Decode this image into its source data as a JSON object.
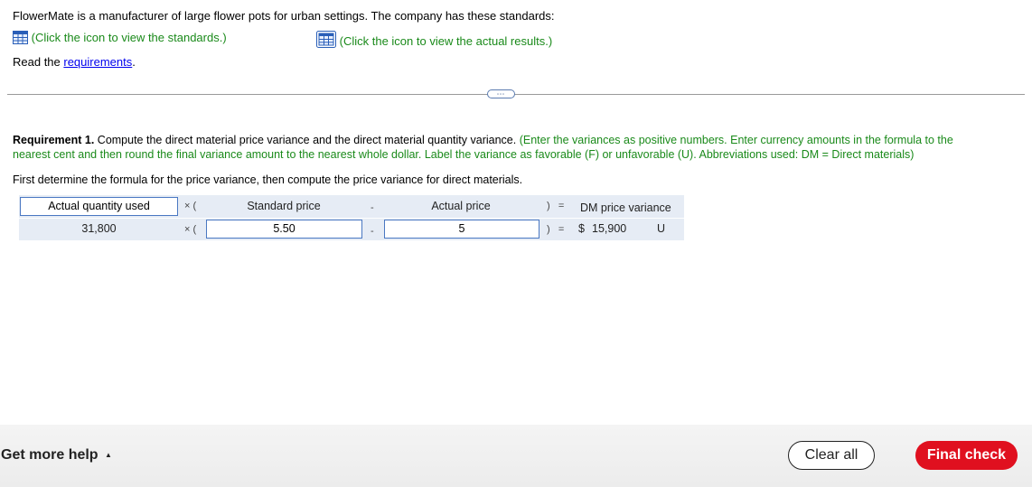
{
  "intro": "FlowerMate is a manufacturer of large flower pots for urban settings. The company has these standards:",
  "links": {
    "standards": "(Click the icon to view the standards.)",
    "actual": "(Click the icon to view the actual results.)"
  },
  "read_prefix": "Read the ",
  "requirements_link": "requirements",
  "read_suffix": ".",
  "more_button": "⋯",
  "requirement": {
    "label": "Requirement 1.",
    "text": " Compute the direct material price variance and the direct material quantity variance. ",
    "instructions_line1": "(Enter the variances as positive numbers. Enter currency amounts in the formula to the",
    "instructions_line2": "nearest cent and then round the final variance amount to the nearest whole dollar. Label the variance as favorable (F) or unfavorable (U). Abbreviations used: DM = Direct materials)"
  },
  "prompt": "First determine the formula for the price variance, then compute the price variance for direct materials.",
  "formula": {
    "header": {
      "actual_quantity": "Actual quantity used",
      "times_open": "× (",
      "standard_price": "Standard price",
      "minus": "-",
      "actual_price": "Actual price",
      "close_eq": ")   =",
      "result_label": "DM price variance"
    },
    "row": {
      "actual_quantity": "31,800",
      "times_open": "× (",
      "standard_price": "5.50",
      "minus": "-",
      "actual_price": "5",
      "close_eq": ")   =",
      "currency": "$",
      "variance": "15,900",
      "label": "U"
    }
  },
  "footer": {
    "help": "Get more help",
    "help_arrow": "▲",
    "clear": "Clear all",
    "final": "Final check"
  },
  "colors": {
    "green": "#1a8a1a",
    "link": "#0000ee",
    "accent": "#e0101f",
    "input_border": "#4a78c2"
  }
}
